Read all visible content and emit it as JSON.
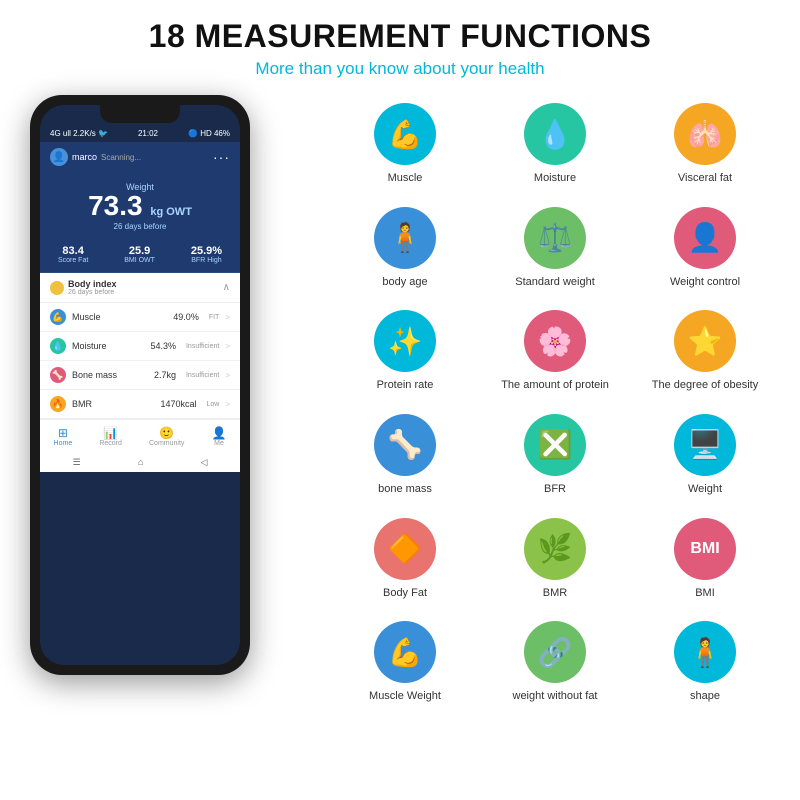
{
  "header": {
    "title": "18 MEASUREMENT FUNCTIONS",
    "subtitle": "More than you know about your health"
  },
  "phone": {
    "status_bar": {
      "left": "4G ull 2.2K/s 🐦",
      "time": "21:02",
      "right": "🔵 ⏰ HD 📶 46%"
    },
    "user": "marco",
    "scanning": "Scanning...",
    "weight_label": "Weight",
    "weight_value": "73.3",
    "weight_unit": "kg OWT",
    "weight_days": "26 days before",
    "stats": [
      {
        "value": "83.4",
        "label": "Score Fat"
      },
      {
        "value": "25.9",
        "label": "BMI OWT"
      },
      {
        "value": "25.9%",
        "label": "BFR High"
      }
    ],
    "body_index_title": "Body index",
    "body_index_sub": "26 days before",
    "metrics": [
      {
        "name": "Muscle",
        "value": "49.0%",
        "status": "FIT",
        "color": "#3a8fd9"
      },
      {
        "name": "Moisture",
        "value": "54.3%",
        "status": "Insufficient",
        "color": "#26c6a2"
      },
      {
        "name": "Bone mass",
        "value": "2.7kg",
        "status": "Insufficient",
        "color": "#e05a7a"
      },
      {
        "name": "BMR",
        "value": "1470kcal",
        "status": "Low",
        "color": "#f5a623"
      }
    ],
    "nav": [
      "Home",
      "Record",
      "Community",
      "Me"
    ]
  },
  "icons": [
    {
      "label": "Muscle",
      "icon": "💪",
      "color_class": "ic-blue"
    },
    {
      "label": "Moisture",
      "icon": "💧",
      "color_class": "ic-teal"
    },
    {
      "label": "Visceral fat",
      "icon": "🫁",
      "color_class": "ic-yellow"
    },
    {
      "label": "body age",
      "icon": "🧍",
      "color_class": "ic-blue2"
    },
    {
      "label": "Standard weight",
      "icon": "⚖️",
      "color_class": "ic-green"
    },
    {
      "label": "Weight control",
      "icon": "👤",
      "color_class": "ic-pink"
    },
    {
      "label": "Protein rate",
      "icon": "✳️",
      "color_class": "ic-blue"
    },
    {
      "label": "The amount of protein",
      "icon": "🌸",
      "color_class": "ic-red"
    },
    {
      "label": "The degree of obesity",
      "icon": "⭐",
      "color_class": "ic-orange"
    },
    {
      "label": "bone mass",
      "icon": "🦴",
      "color_class": "ic-blue2"
    },
    {
      "label": "BFR",
      "icon": "🔷",
      "color_class": "ic-teal"
    },
    {
      "label": "Weight",
      "icon": "🖥️",
      "color_class": "ic-cyan"
    },
    {
      "label": "Body Fat",
      "icon": "🔶",
      "color_class": "ic-coral"
    },
    {
      "label": "BMR",
      "icon": "🌿",
      "color_class": "ic-lime"
    },
    {
      "label": "BMI",
      "icon": "BMI",
      "color_class": "ic-red"
    },
    {
      "label": "Muscle Weight",
      "icon": "💪",
      "color_class": "ic-blue2"
    },
    {
      "label": "weight without fat",
      "icon": "🔗",
      "color_class": "ic-green"
    },
    {
      "label": "shape",
      "icon": "🧍",
      "color_class": "ic-blue"
    }
  ]
}
